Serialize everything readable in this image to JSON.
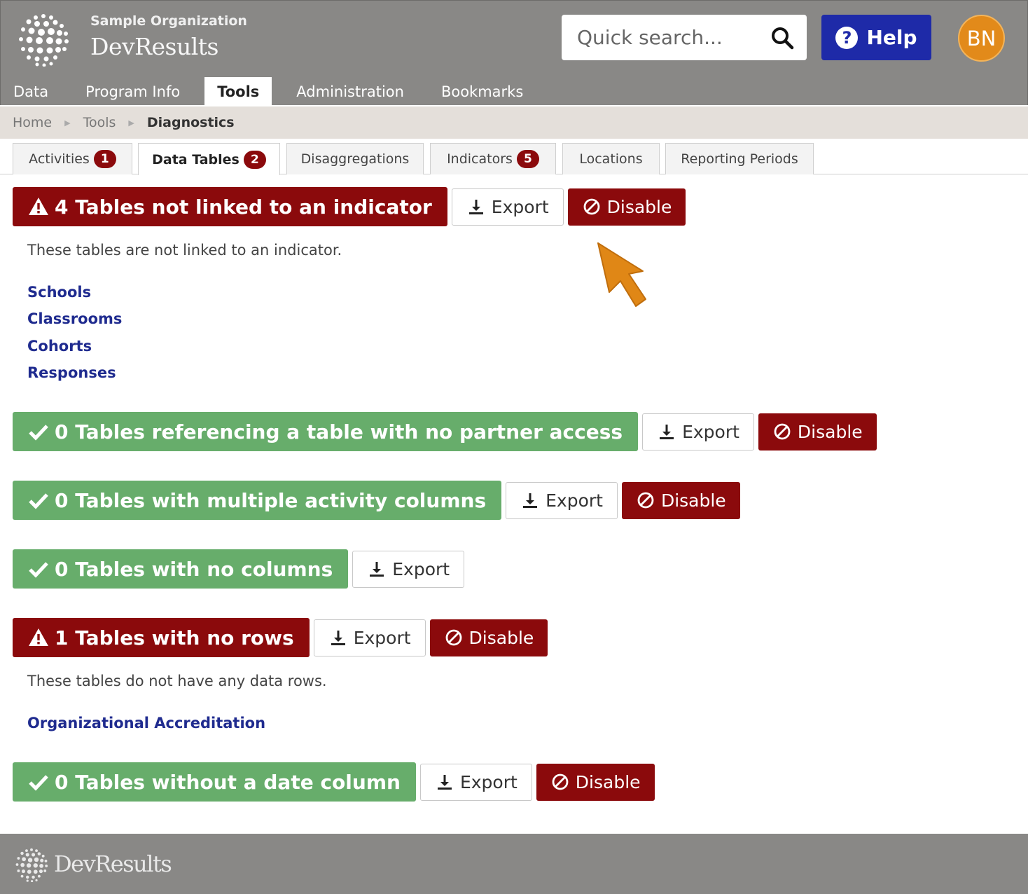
{
  "header": {
    "org_name": "Sample Organization",
    "app_name": "DevResults",
    "search_placeholder": "Quick search...",
    "help_label": "Help",
    "avatar_initials": "BN"
  },
  "nav": {
    "items": [
      "Data",
      "Program Info",
      "Tools",
      "Administration",
      "Bookmarks"
    ],
    "active": "Tools"
  },
  "breadcrumb": [
    "Home",
    "Tools",
    "Diagnostics"
  ],
  "tabs": [
    {
      "label": "Activities",
      "badge": "1"
    },
    {
      "label": "Data Tables",
      "badge": "2",
      "active": true
    },
    {
      "label": "Disaggregations",
      "badge": ""
    },
    {
      "label": "Indicators",
      "badge": "5"
    },
    {
      "label": "Locations",
      "badge": ""
    },
    {
      "label": "Reporting Periods",
      "badge": ""
    }
  ],
  "buttons": {
    "export": "Export",
    "disable": "Disable"
  },
  "diagnostics": [
    {
      "status": "error",
      "title": "4 Tables not linked to an indicator",
      "description": "These tables are not linked to an indicator.",
      "links": [
        "Schools",
        "Classrooms",
        "Cohorts",
        "Responses"
      ]
    },
    {
      "status": "ok",
      "title": "0 Tables referencing a table with no partner access"
    },
    {
      "status": "ok",
      "title": "0 Tables with multiple activity columns"
    },
    {
      "status": "ok",
      "title": "0 Tables with no columns"
    },
    {
      "status": "error",
      "title": "1 Tables with no rows",
      "description": "These tables do not have any data rows.",
      "links": [
        "Organizational Accreditation"
      ]
    },
    {
      "status": "ok",
      "title": "0 Tables without a date column"
    }
  ],
  "colors": {
    "header_bg": "#898886",
    "error": "#8b0a0c",
    "success": "#67ad6b",
    "help": "#1e2aa8",
    "avatar": "#e28a1a",
    "link": "#1f2b8f",
    "pointer": "#e08716"
  },
  "icons": {
    "logo": "globe-dots-icon",
    "search": "search-icon",
    "help": "question-circle-icon",
    "error": "warning-triangle-icon",
    "ok": "check-icon",
    "export": "download-icon",
    "disable": "ban-icon",
    "annotation": "pointer-arrow-icon"
  },
  "footer": {
    "app_name": "DevResults"
  }
}
